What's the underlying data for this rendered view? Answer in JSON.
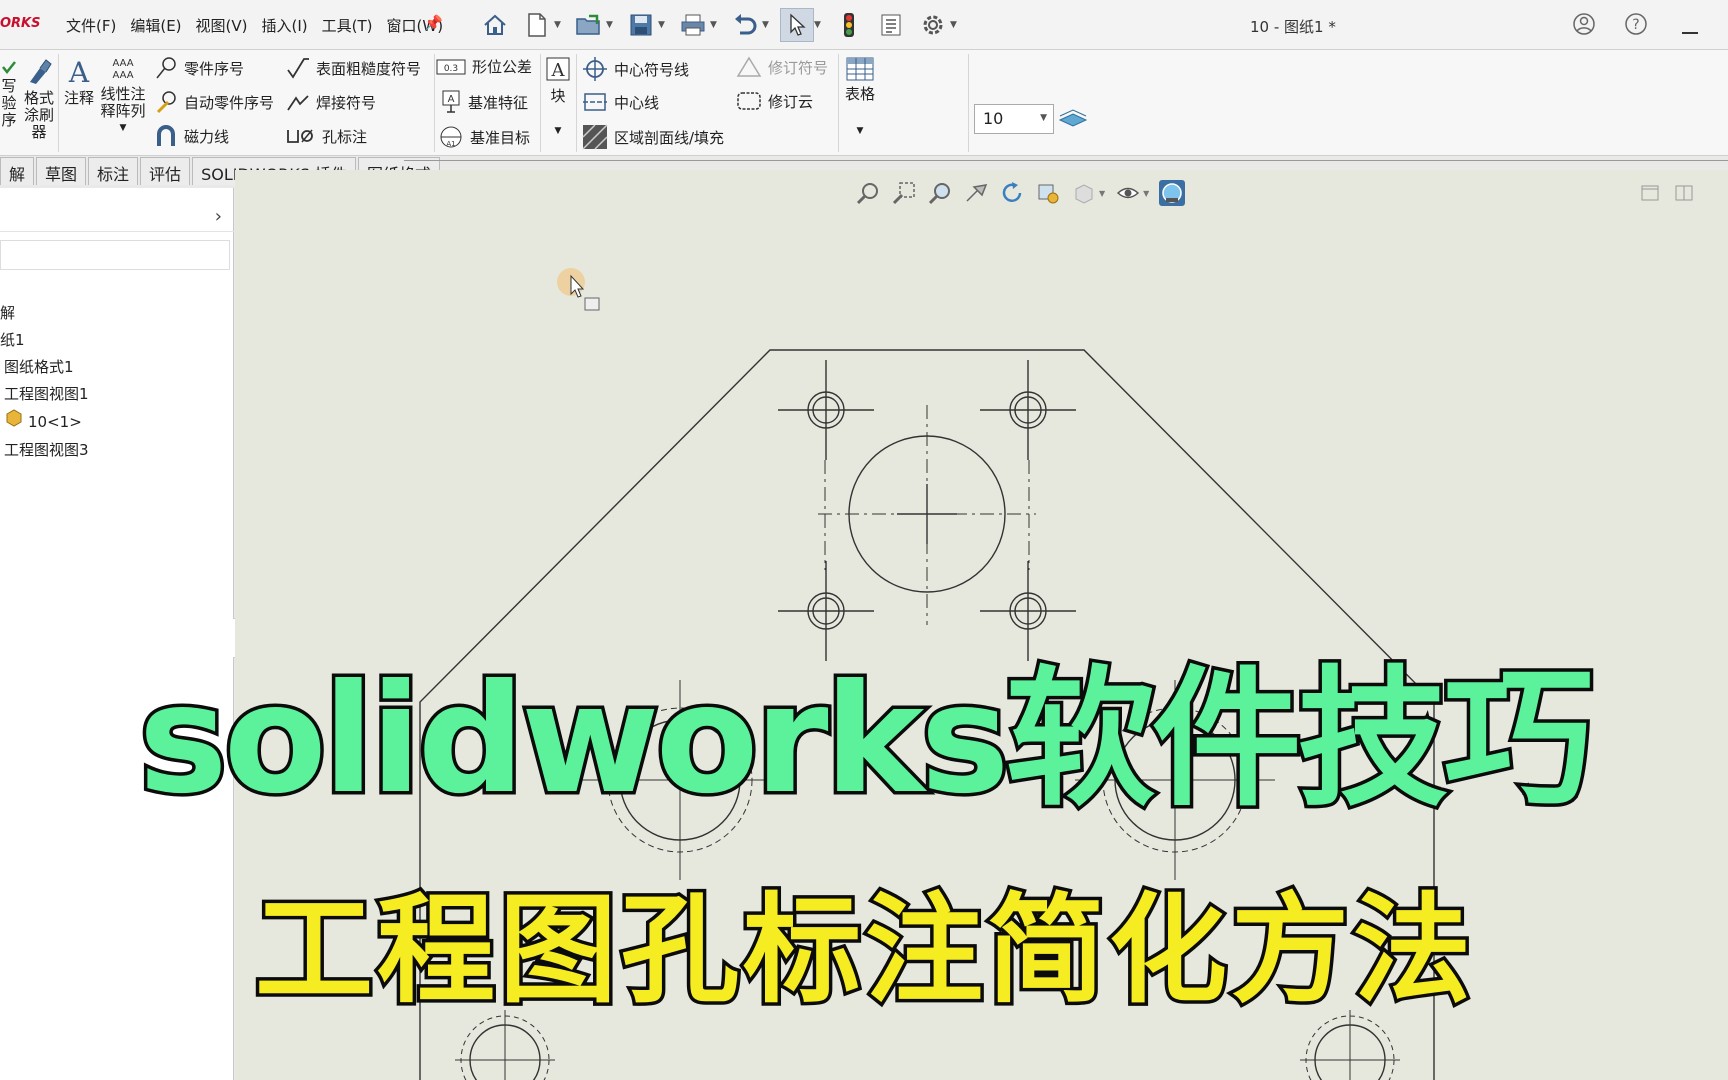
{
  "app": {
    "logo": "ORKS",
    "doc_title": "10 - 图纸1 *"
  },
  "menu": [
    "文件(F)",
    "编辑(E)",
    "视图(V)",
    "插入(I)",
    "工具(T)",
    "窗口(W)"
  ],
  "ribbon": {
    "left_big": [
      "写",
      "验",
      "序"
    ],
    "format_painter": "格式\n涂刷\n器",
    "note": "注释",
    "linear_note_array": "线性注\n释阵列",
    "balloon": "零件序号",
    "auto_balloon": "自动零件序号",
    "magnetic_line": "磁力线",
    "surface_finish": "表面粗糙度符号",
    "weld_symbol": "焊接符号",
    "hole_callout": "孔标注",
    "geometric_tolerance": "形位公差",
    "datum_feature": "基准特征",
    "datum_target": "基准目标",
    "block": "块",
    "center_mark": "中心符号线",
    "centerline": "中心线",
    "area_hatch": "区域剖面线/填充",
    "revision_symbol": "修订符号",
    "revision_cloud": "修订云",
    "table": "表格",
    "zoom_value": "10"
  },
  "tabs": [
    "解",
    "草图",
    "标注",
    "评估",
    "SOLIDWORKS 插件",
    "图纸格式"
  ],
  "tree": [
    "解",
    "纸1",
    "图纸格式1",
    "工程图视图1",
    "10<1>",
    "工程图视图3"
  ],
  "overlay": {
    "line1": "solidworks软件技巧",
    "line2": "工程图孔标注简化方法"
  }
}
